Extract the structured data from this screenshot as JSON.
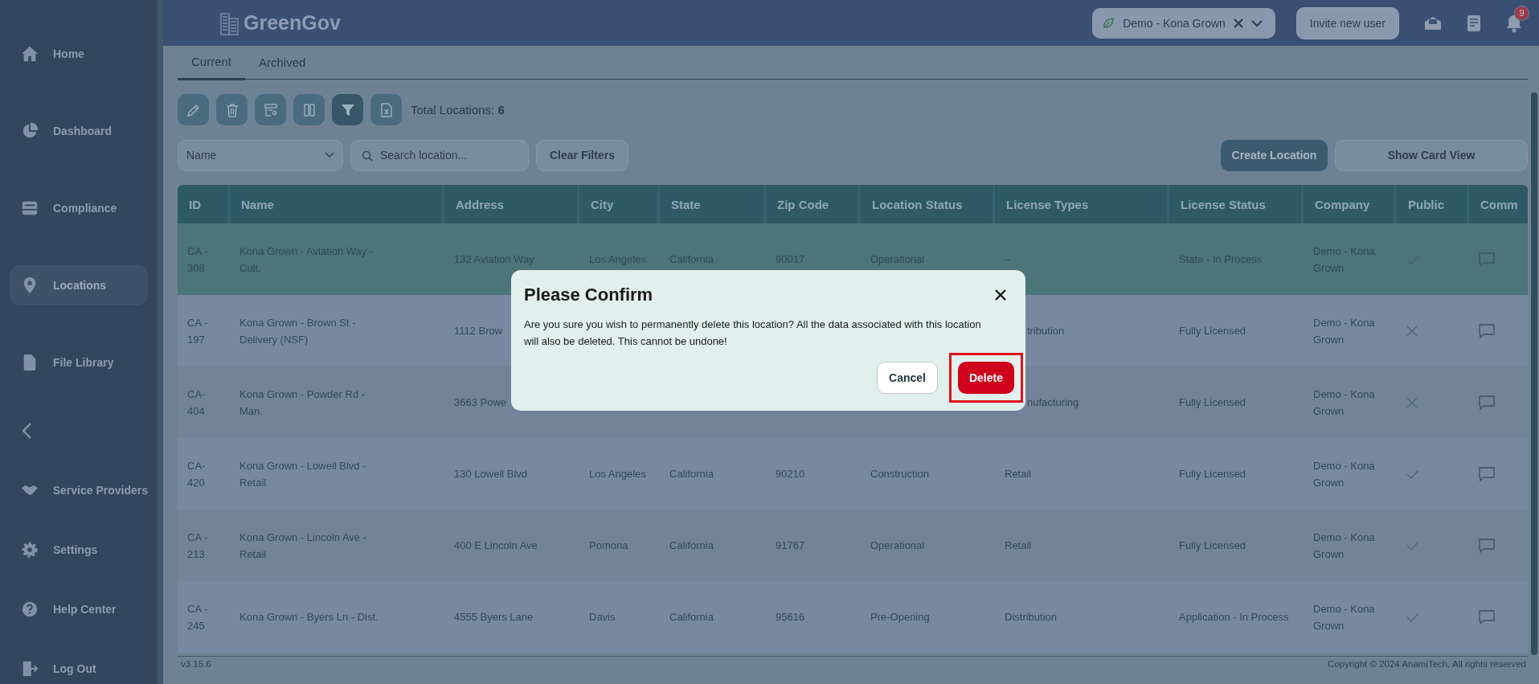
{
  "app": {
    "name": "GreenGov"
  },
  "sidebar": {
    "items": [
      {
        "kind": "home",
        "label": "Home",
        "selected": false
      },
      {
        "kind": "dashboard",
        "label": "Dashboard",
        "selected": false
      },
      {
        "kind": "compliance",
        "label": "Compliance",
        "selected": false
      },
      {
        "kind": "locations",
        "label": "Locations",
        "selected": true
      },
      {
        "kind": "files",
        "label": "File Library",
        "selected": false
      },
      {
        "kind": "collapse"
      },
      {
        "kind": "providers",
        "label": "Service Providers",
        "selected": false
      },
      {
        "kind": "settings",
        "label": "Settings",
        "selected": false
      },
      {
        "kind": "help",
        "label": "Help Center",
        "selected": false
      },
      {
        "kind": "logout",
        "label": "Log Out",
        "selected": false
      }
    ]
  },
  "topbar": {
    "company": "Demo - Kona Grown",
    "invite": "Invite new user",
    "notifications": "9"
  },
  "tabs": [
    {
      "label": "Current",
      "selected": true
    },
    {
      "label": "Archived",
      "selected": false
    }
  ],
  "toolbar": {
    "buttons": [
      {
        "kind": "edit",
        "active": false
      },
      {
        "kind": "delete",
        "active": false
      },
      {
        "kind": "archive",
        "active": false
      },
      {
        "kind": "columns",
        "active": false
      },
      {
        "kind": "filter",
        "active": true
      },
      {
        "kind": "export",
        "active": false
      }
    ],
    "total_label": "Total Locations:",
    "total": "6"
  },
  "filters": {
    "field": "Name",
    "search": {
      "placeholder": "Search location..."
    },
    "clear": "Clear Filters",
    "create": "Create Location",
    "card_view": "Show Card View"
  },
  "table": {
    "columns": [
      "ID",
      "Name",
      "Address",
      "City",
      "State",
      "Zip Code",
      "Location Status",
      "License Types",
      "License Status",
      "Company",
      "Public",
      "Comm"
    ],
    "rows": [
      {
        "selected": true,
        "public": true,
        "cells": [
          "CA - 308",
          "Kona Grown - Aviation Way - Cult.",
          "132 Aviation Way",
          "Los Angeles",
          "California",
          "90017",
          "Operational",
          "–",
          "State - In Process",
          "Demo - Kona Grown"
        ]
      },
      {
        "selected": false,
        "public": false,
        "cells": [
          "CA - 197",
          "Kona Grown - Brown St - Delivery (NSF)",
          "1112 Brow",
          null,
          null,
          null,
          null,
          {
            "text": "tribution",
            "covered": true
          },
          "Fully Licensed",
          "Demo - Kona Grown"
        ]
      },
      {
        "selected": false,
        "public": false,
        "cells": [
          "CA-404",
          "Kona Grown - Powder Rd - Man.",
          "3663 Powe",
          null,
          null,
          null,
          null,
          {
            "text": "nufacturing",
            "covered": true
          },
          "Fully Licensed",
          "Demo - Kona Grown"
        ]
      },
      {
        "selected": false,
        "public": true,
        "cells": [
          "CA-420",
          "Kona Grown - Lowell Blvd - Retail",
          "130 Lowell Blvd",
          "Los Angeles",
          "California",
          "90210",
          "Construction",
          "Retail",
          "Fully Licensed",
          "Demo - Kona Grown"
        ]
      },
      {
        "selected": false,
        "public": true,
        "cells": [
          "CA - 213",
          "Kona Grown - Lincoln Ave - Retail",
          "400 E Lincoln Ave",
          "Pomona",
          "California",
          "91767",
          "Operational",
          "Retail",
          "Fully Licensed",
          "Demo - Kona Grown"
        ]
      },
      {
        "selected": false,
        "public": true,
        "cells": [
          "CA - 245",
          "Kona Grown - Byers Ln - Dist.",
          "4555 Byers Lane",
          "Davis",
          "California",
          "95616",
          "Pre-Opening",
          "Distribution",
          "Application - In Process",
          "Demo - Kona Grown"
        ]
      }
    ]
  },
  "dialog": {
    "title": "Please Confirm",
    "message": "Are you sure you wish to permanently delete this location? All the data associated with this location will also be deleted. This cannot be undone!",
    "buttons": [
      {
        "label": "Cancel",
        "kind": "secondary",
        "highlighted": false
      },
      {
        "label": "Delete",
        "kind": "danger",
        "highlighted": true
      }
    ]
  },
  "footer": {
    "version": "v3.15.6",
    "copyright": "Copyright © 2024 AnamiTech, All rights reserved"
  }
}
